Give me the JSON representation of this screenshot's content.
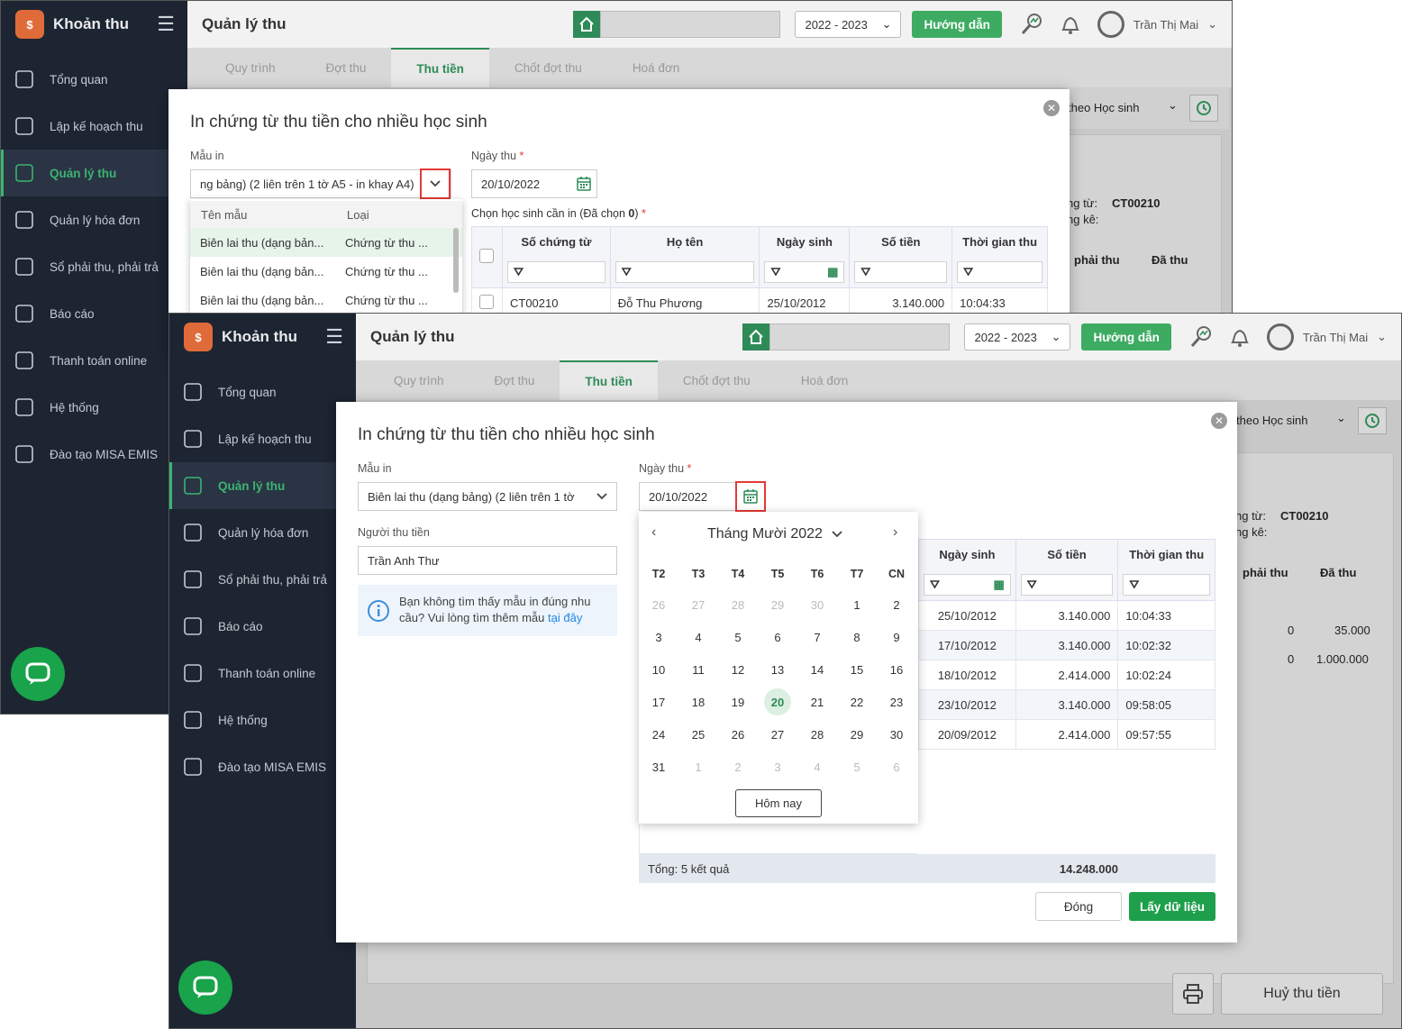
{
  "colors": {
    "sidebar": "#1d2532",
    "accent": "#2e8b57",
    "button_green": "#2aa553",
    "required": "#e53935",
    "highlight_box": "#e53935"
  },
  "app": {
    "name": "Khoản thu",
    "page_title": "Quản lý thu",
    "year": "2022 - 2023",
    "guide_label": "Hướng dẫn",
    "user_name": "Trần Thị Mai"
  },
  "sidebar": {
    "items": [
      {
        "label": "Tổng quan",
        "icon": "bar-chart-icon"
      },
      {
        "label": "Lập kế hoạch thu",
        "icon": "calendar-money-icon"
      },
      {
        "label": "Quản lý thu",
        "icon": "hand-coin-icon"
      },
      {
        "label": "Quản lý hóa đơn",
        "icon": "invoice-icon"
      },
      {
        "label": "Sổ phải thu, phải trả",
        "icon": "ledger-icon"
      },
      {
        "label": "Báo cáo",
        "icon": "pie-chart-icon"
      },
      {
        "label": "Thanh toán online",
        "icon": "online-payment-icon"
      },
      {
        "label": "Hệ thống",
        "icon": "gear-icon"
      },
      {
        "label": "Đào tạo MISA EMIS",
        "icon": "book-icon"
      }
    ]
  },
  "tabs": [
    "Quy trình",
    "Đợt thu",
    "Thu tiền",
    "Chốt đợt thu",
    "Hoá đơn"
  ],
  "background": {
    "filter_by": "theo Học sinh",
    "voucher_label_1": "ng từ:",
    "voucher_code": "CT00210",
    "voucher_label_2": "ng kê:",
    "col_must_pay": "phải thu",
    "col_paid": "Đã thu",
    "row1": {
      "must": "0",
      "paid": "35.000"
    },
    "row2": {
      "must": "0",
      "paid": "1.000.000"
    },
    "cancel_label": "Huỷ thu tiền"
  },
  "modal": {
    "title": "In chứng từ thu tiền cho nhiều học sinh",
    "template_label": "Mẫu in",
    "template_value_1": "ng bảng) (2 liên trên 1 tờ A5 - in khay A4)",
    "template_value_2": "Biên lai thu (dạng bảng) (2 liên trên 1 tờ",
    "date_label": "Ngày thu",
    "required_mark": "*",
    "date_value": "20/10/2022",
    "collector_label": "Người thu tiền",
    "collector_value": "Trần Anh Thư",
    "info_text": "Bạn không tìm thấy mẫu in đúng nhu cầu? Vui lòng tìm thêm mẫu",
    "info_link": "tại đây",
    "select_students_label": "Chọn học sinh cần in (Đã chọn",
    "selected_count": "0",
    "select_students_close": ")",
    "columns": [
      "Số chứng từ",
      "Họ tên",
      "Ngày sinh",
      "Số tiền",
      "Thời gian thu"
    ],
    "first_row": {
      "voucher": "CT00210",
      "name": "Đỗ Thu Phương",
      "dob": "25/10/2012",
      "amount": "3.140.000",
      "time": "10:04:33"
    },
    "rows": [
      {
        "dob": "25/10/2012",
        "amount": "3.140.000",
        "time": "10:04:33"
      },
      {
        "dob": "17/10/2012",
        "amount": "3.140.000",
        "time": "10:02:32"
      },
      {
        "dob": "18/10/2012",
        "amount": "2.414.000",
        "time": "10:02:24"
      },
      {
        "dob": "23/10/2012",
        "amount": "3.140.000",
        "time": "09:58:05"
      },
      {
        "dob": "20/09/2012",
        "amount": "2.414.000",
        "time": "09:57:55"
      }
    ],
    "total_label": "Tổng: 5 kết quả",
    "total_amount": "14.248.000",
    "close_label": "Đóng",
    "fetch_label": "Lấy dữ liệu"
  },
  "template_dropdown": {
    "col_name": "Tên mẫu",
    "col_type": "Loại",
    "rows": [
      {
        "name": "Biên lai thu (dạng bản...",
        "type": "Chứng từ thu ..."
      },
      {
        "name": "Biên lai thu (dạng bản...",
        "type": "Chứng từ thu ..."
      },
      {
        "name": "Biên lai thu (dạng bản...",
        "type": "Chứng từ thu ..."
      }
    ]
  },
  "calendar": {
    "month_label": "Tháng Mười 2022",
    "weekdays": [
      "T2",
      "T3",
      "T4",
      "T5",
      "T6",
      "T7",
      "CN"
    ],
    "days": [
      "26",
      "27",
      "28",
      "29",
      "30",
      "1",
      "2",
      "3",
      "4",
      "5",
      "6",
      "7",
      "8",
      "9",
      "10",
      "11",
      "12",
      "13",
      "14",
      "15",
      "16",
      "17",
      "18",
      "19",
      "20",
      "21",
      "22",
      "23",
      "24",
      "25",
      "26",
      "27",
      "28",
      "29",
      "30",
      "31",
      "1",
      "2",
      "3",
      "4",
      "5",
      "6"
    ],
    "selected_day": "20",
    "today_label": "Hôm nay"
  }
}
